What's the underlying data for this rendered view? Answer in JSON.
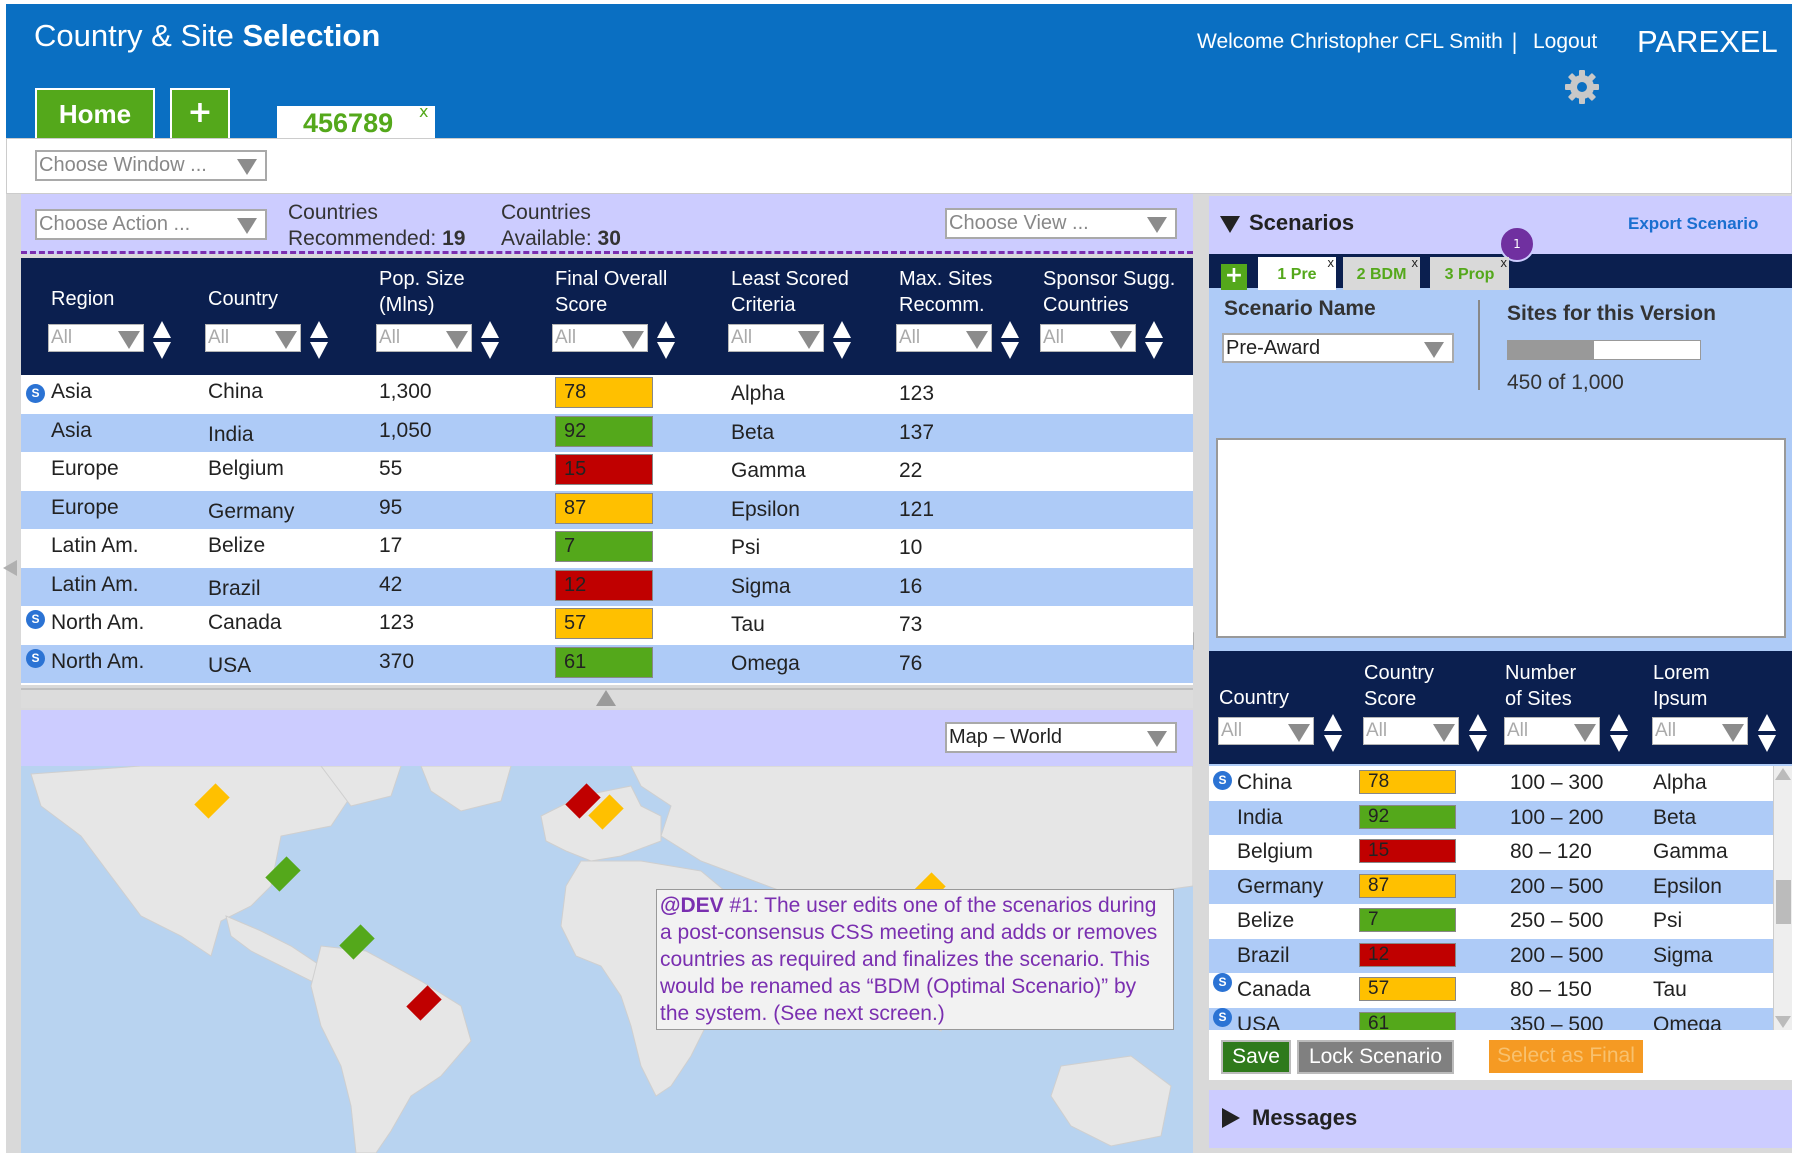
{
  "header": {
    "title_light": "Country & Site ",
    "title_bold": "Selection",
    "welcome": "Welcome Christopher CFL Smith",
    "separator": "|",
    "logout": "Logout",
    "brand": "PAREXEL"
  },
  "tabs": {
    "home": "Home",
    "add": "+",
    "project_id": "456789",
    "close": "x"
  },
  "toolbar": {
    "choose_window": "Choose Window ..."
  },
  "left": {
    "choose_action": "Choose Action ...",
    "rec_label": "Countries",
    "rec_label2": "Recommended:",
    "rec_value": "19",
    "avail_label": "Countries",
    "avail_label2": "Available:",
    "avail_value": "30",
    "choose_view": "Choose View ..."
  },
  "table": {
    "headers": [
      [
        "Region"
      ],
      [
        "Country"
      ],
      [
        "Pop. Size",
        "(Mlns)"
      ],
      [
        "Final Overall",
        "Score"
      ],
      [
        "Least Scored",
        "Criteria"
      ],
      [
        "Max. Sites",
        "Recomm."
      ],
      [
        "Sponsor Sugg.",
        "Countries"
      ]
    ],
    "filter": "All",
    "rows": [
      {
        "region": "Asia",
        "country": "China",
        "pop": "1,300",
        "score": "78",
        "color": "#ffc000",
        "crit": "Alpha",
        "sites": "123",
        "s": true
      },
      {
        "region": "Asia",
        "country": "India",
        "pop": "1,050",
        "score": "92",
        "color": "#54a81b",
        "crit": "Beta",
        "sites": "137",
        "s": false
      },
      {
        "region": "Europe",
        "country": "Belgium",
        "pop": "55",
        "score": "15",
        "color": "#c00000",
        "crit": "Gamma",
        "sites": "22",
        "s": false
      },
      {
        "region": "Europe",
        "country": "Germany",
        "pop": "95",
        "score": "87",
        "color": "#ffc000",
        "crit": "Epsilon",
        "sites": "121",
        "s": false
      },
      {
        "region": "Latin Am.",
        "country": "Belize",
        "pop": "17",
        "score": "7",
        "color": "#54a81b",
        "crit": "Psi",
        "sites": "10",
        "s": false
      },
      {
        "region": "Latin Am.",
        "country": "Brazil",
        "pop": "42",
        "score": "12",
        "color": "#c00000",
        "crit": "Sigma",
        "sites": "16",
        "s": false
      },
      {
        "region": "North Am.",
        "country": "Canada",
        "pop": "123",
        "score": "57",
        "color": "#ffc000",
        "crit": "Tau",
        "sites": "73",
        "s": true
      },
      {
        "region": "North Am.",
        "country": "USA",
        "pop": "370",
        "score": "61",
        "color": "#54a81b",
        "crit": "Omega",
        "sites": "76",
        "s": true
      }
    ]
  },
  "map": {
    "select": "Map – World"
  },
  "note": {
    "dev": "@DEV",
    "text": " #1: The user edits one of the scenarios during a post-consensus CSS meeting and adds or removes countries as required and finalizes the scenario. This would be renamed as “BDM (Optimal Scenario)” by the system. (See next screen.)"
  },
  "scenarios": {
    "title": "Scenarios",
    "export": "Export Scenario",
    "badge": "1",
    "add": "+",
    "tabs": [
      "1 Pre",
      "2 BDM",
      "3 Prop"
    ],
    "close": "x",
    "name_label": "Scenario Name",
    "name_value": "Pre-Award",
    "sites_label": "Sites for this Version",
    "progress": 0.45,
    "sites_value": "450 of 1,000",
    "headers": [
      [
        "Country"
      ],
      [
        "Country",
        "Score"
      ],
      [
        "Number",
        "of Sites"
      ],
      [
        "Lorem",
        "Ipsum"
      ]
    ],
    "filter": "All",
    "rows": [
      {
        "country": "China",
        "score": "78",
        "color": "#ffc000",
        "sites": "100 – 300",
        "lorem": "Alpha",
        "s": true
      },
      {
        "country": "India",
        "score": "92",
        "color": "#54a81b",
        "sites": "100 – 200",
        "lorem": "Beta",
        "s": false
      },
      {
        "country": "Belgium",
        "score": "15",
        "color": "#c00000",
        "sites": "80 – 120",
        "lorem": "Gamma",
        "s": false
      },
      {
        "country": "Germany",
        "score": "87",
        "color": "#ffc000",
        "sites": "200 – 500",
        "lorem": "Epsilon",
        "s": false
      },
      {
        "country": "Belize",
        "score": "7",
        "color": "#54a81b",
        "sites": "250 – 500",
        "lorem": "Psi",
        "s": false
      },
      {
        "country": "Brazil",
        "score": "12",
        "color": "#c00000",
        "sites": "200 – 500",
        "lorem": "Sigma",
        "s": false
      },
      {
        "country": "Canada",
        "score": "57",
        "color": "#ffc000",
        "sites": "80 – 150",
        "lorem": "Tau",
        "s": true
      },
      {
        "country": "USA",
        "score": "61",
        "color": "#54a81b",
        "sites": "350 – 500",
        "lorem": "Omega",
        "s": true
      }
    ],
    "save": "Save",
    "lock": "Lock Scenario",
    "final": "Select as Final"
  },
  "messages": {
    "title": "Messages"
  },
  "badge_letter": "S",
  "colors": {
    "brand_blue": "#0a6fc2",
    "navy": "#0b1f4f",
    "lavender": "#ccccff",
    "row_alt": "#aecbf7",
    "green": "#54a81b",
    "yellow": "#ffc000",
    "red": "#c00000"
  }
}
